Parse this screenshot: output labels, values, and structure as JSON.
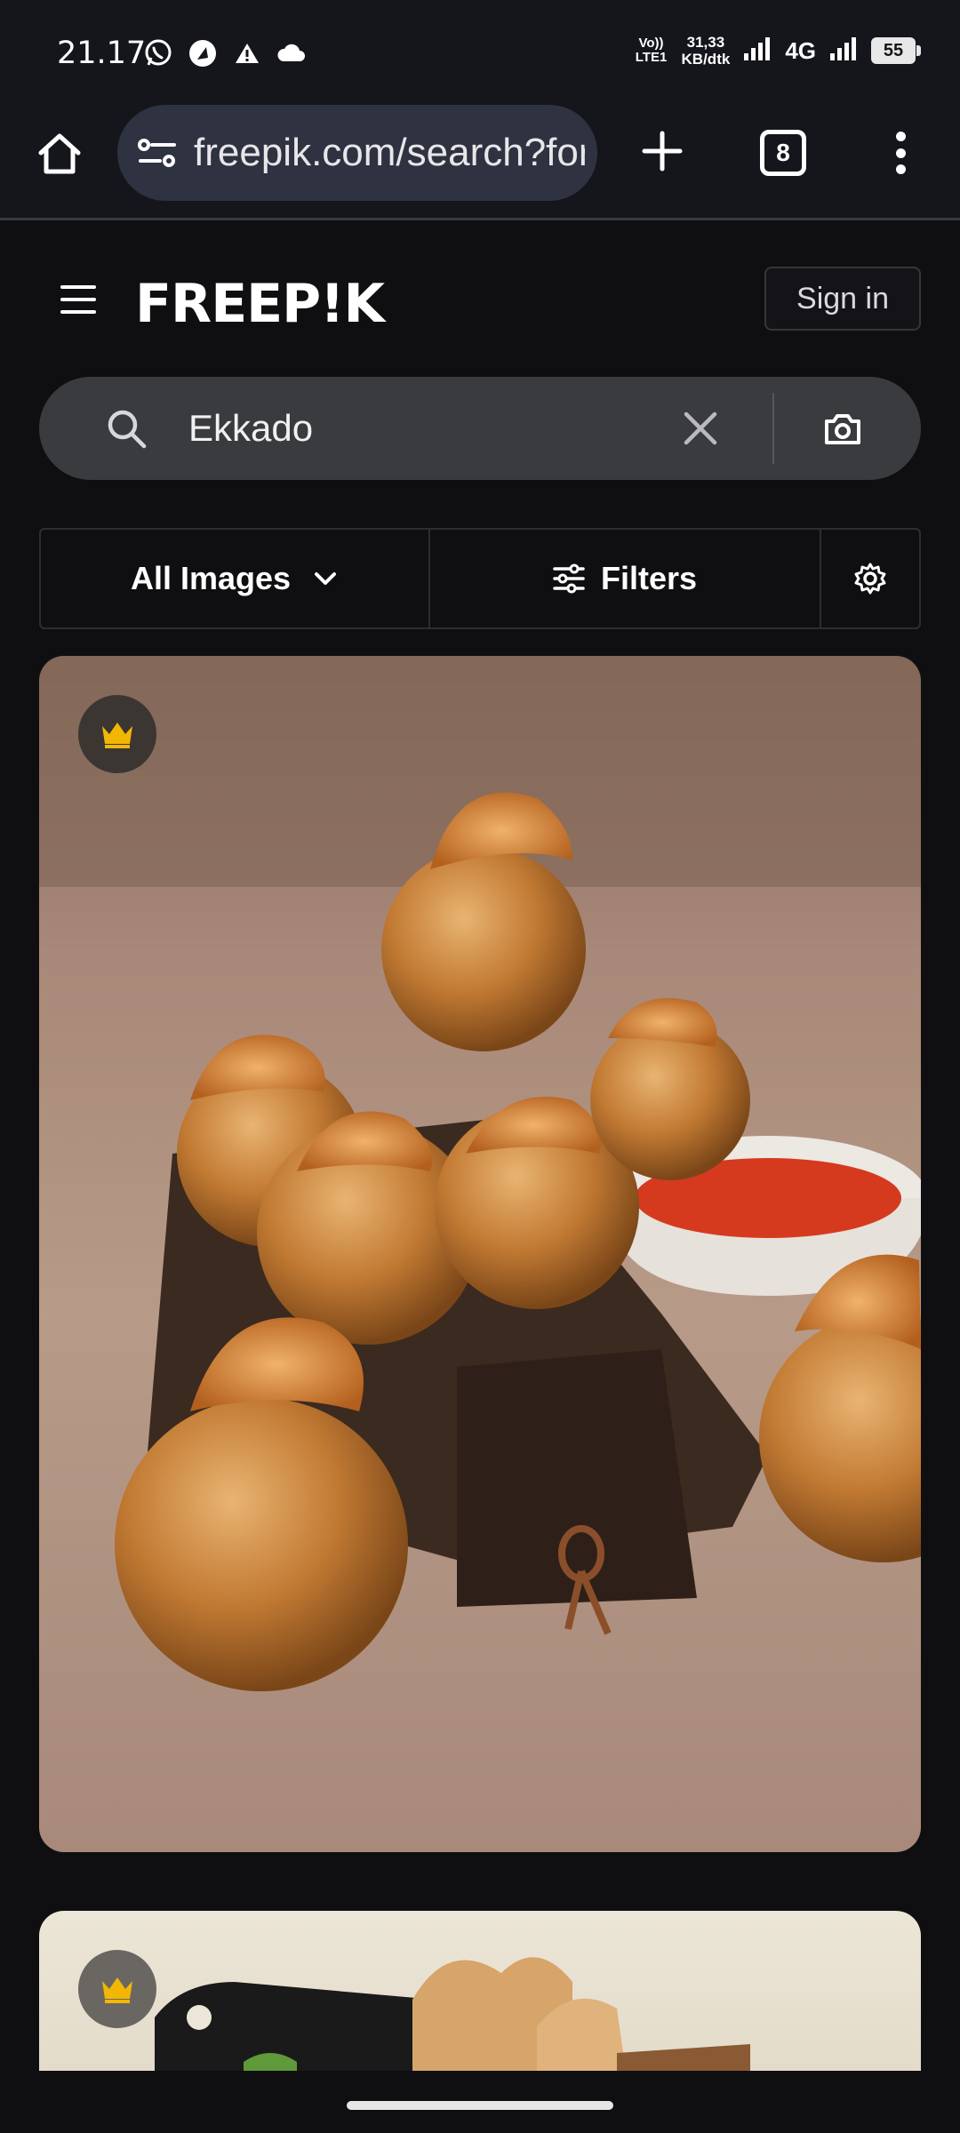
{
  "status_bar": {
    "time": "21.17",
    "volte": "Vo)) LTE1",
    "net_speed_value": "31,33",
    "net_speed_unit": "KB/dtk",
    "network_type": "4G",
    "battery": "55",
    "icons": [
      "whatsapp-icon",
      "navigation-icon",
      "warning-icon",
      "cloud-icon",
      "signal-icon",
      "signal-icon-2"
    ]
  },
  "browser": {
    "url": "freepik.com/search?format=search&query=Ekkado",
    "tab_count": "8",
    "icons": [
      "home-icon",
      "site-settings-icon",
      "new-tab-icon",
      "tab-switcher-icon",
      "more-menu-icon"
    ]
  },
  "header": {
    "logo": "FREEP!K",
    "sign_in": "Sign in"
  },
  "search": {
    "query": "Ekkado"
  },
  "filters": {
    "type_label": "All Images",
    "filters_label": "Filters"
  },
  "results": [
    {
      "premium": true,
      "icon": "crown-icon"
    },
    {
      "premium": true,
      "icon": "crown-icon"
    }
  ],
  "colors": {
    "background": "#0f0f12",
    "bar": "#15161b",
    "url_pill": "#2f3240",
    "search_bar": "#3a3b3f",
    "crown": "#f2b705"
  }
}
